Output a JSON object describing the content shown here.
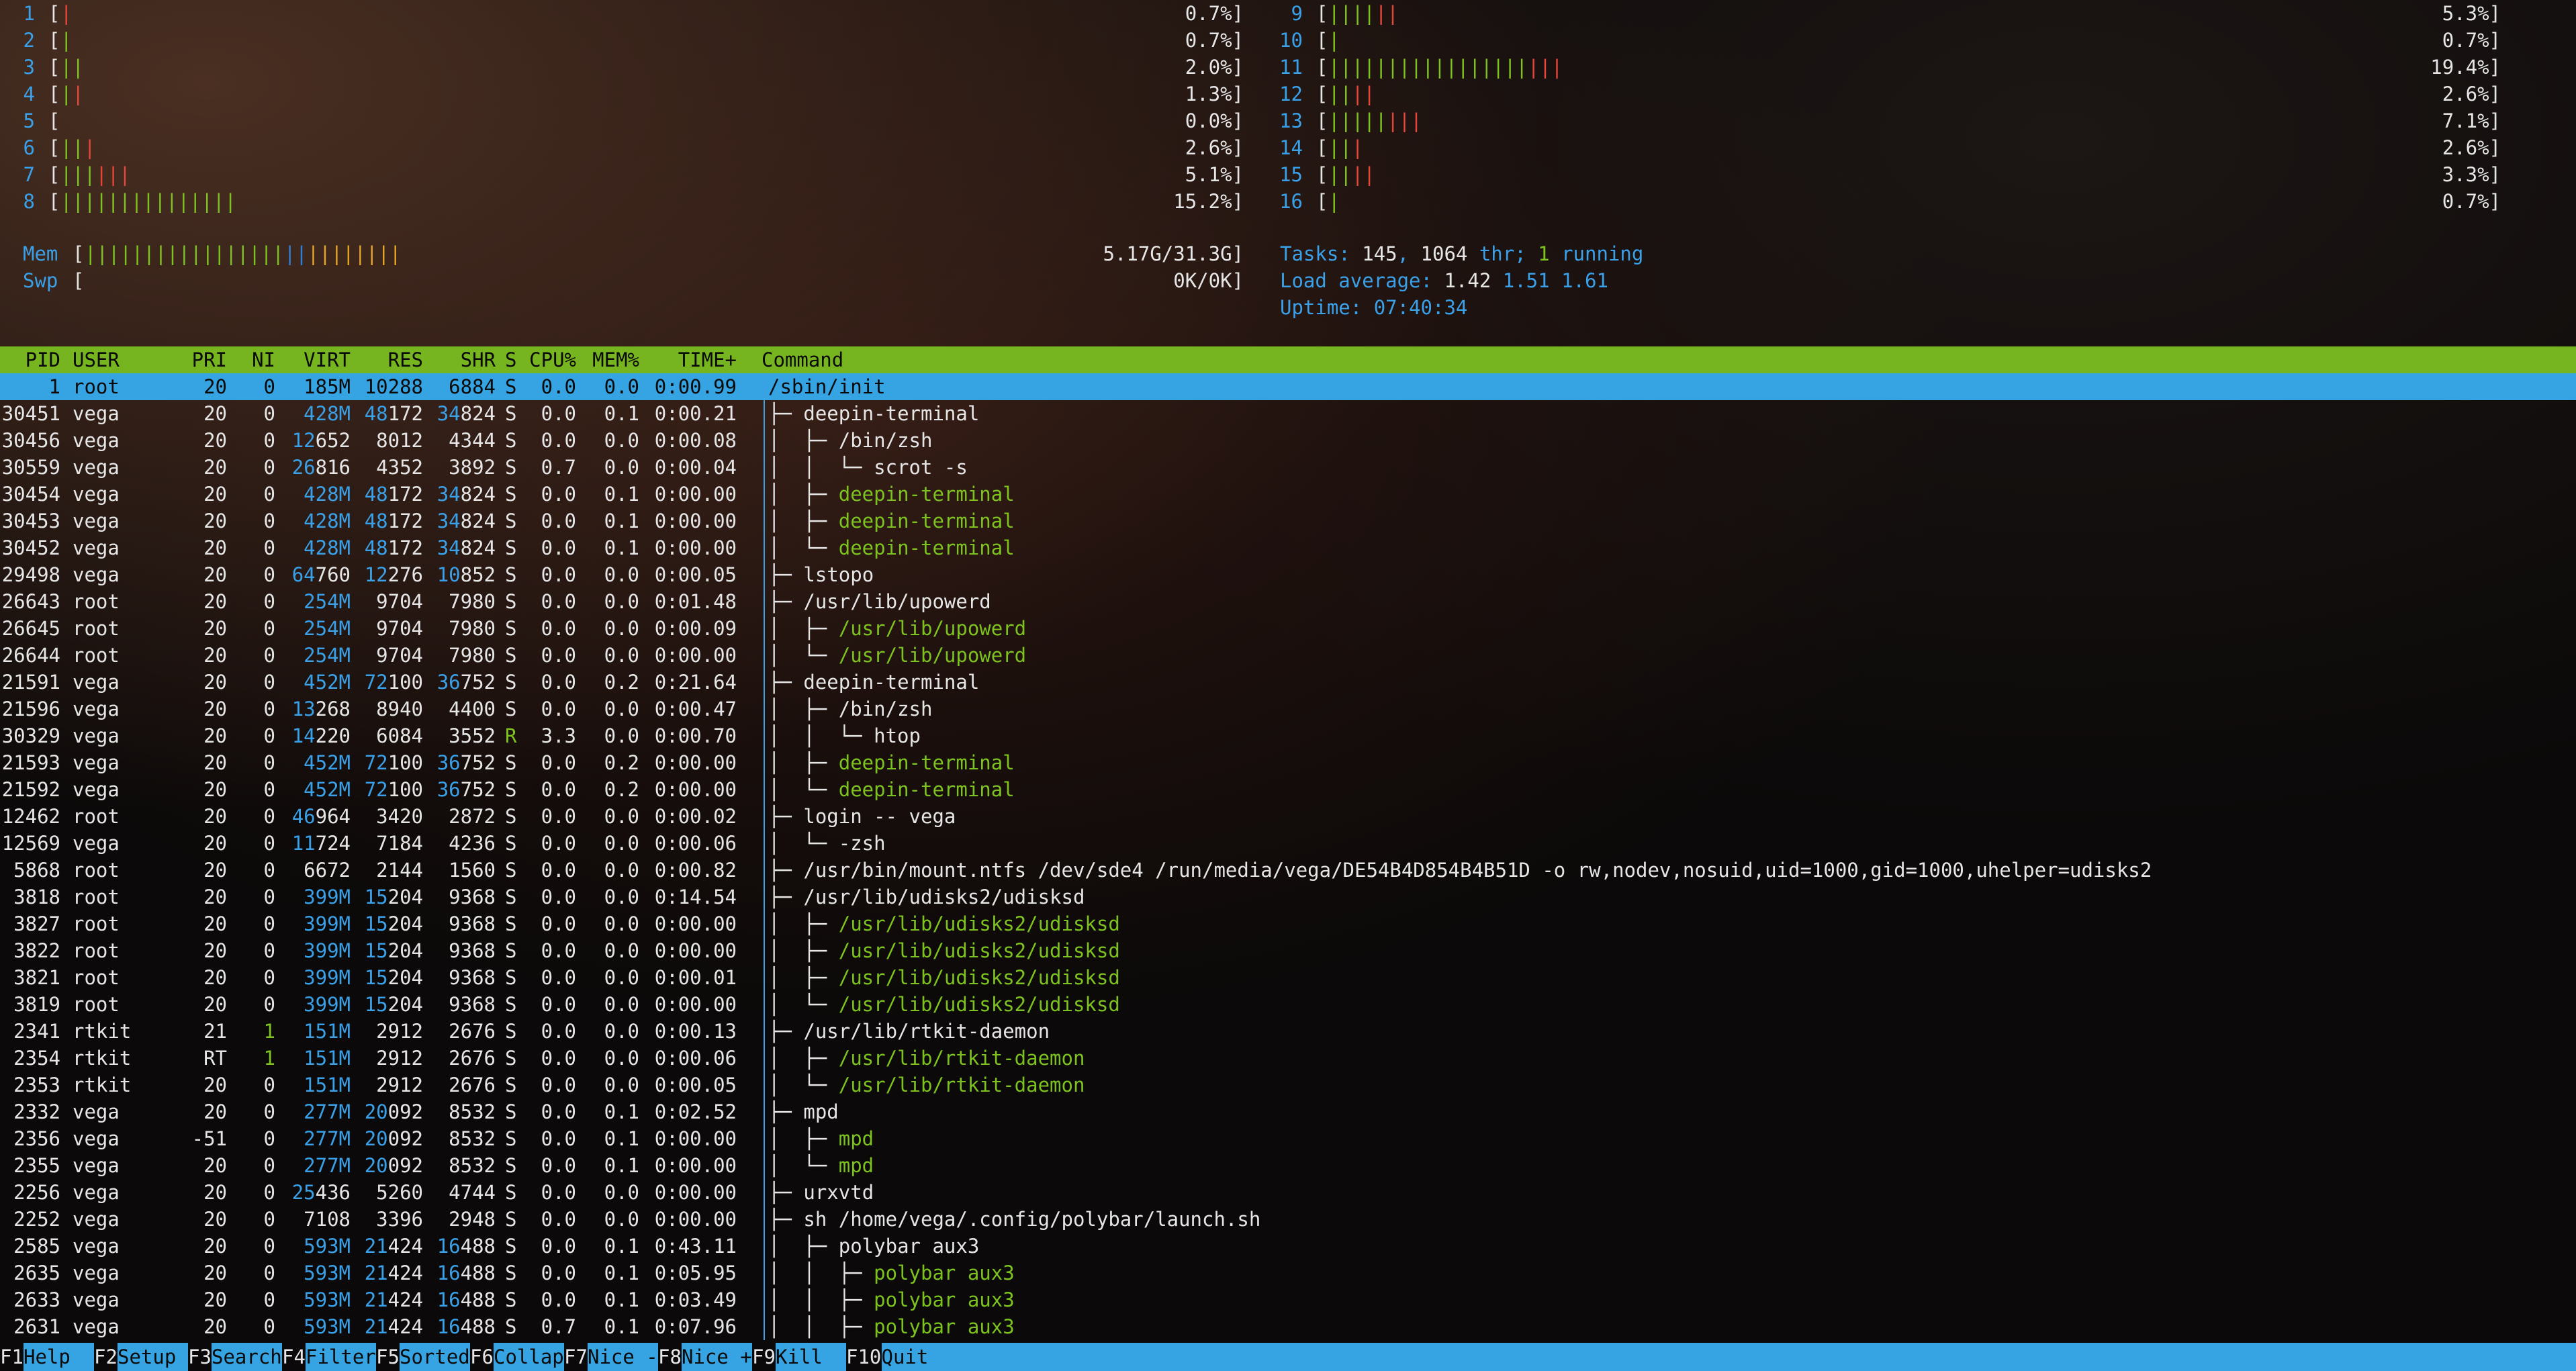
{
  "cpu_left": [
    {
      "id": "1",
      "g": 0,
      "r": 1,
      "val": "0.7%]"
    },
    {
      "id": "2",
      "g": 1,
      "r": 0,
      "val": "0.7%]"
    },
    {
      "id": "3",
      "g": 2,
      "r": 0,
      "val": "2.0%]"
    },
    {
      "id": "4",
      "g": 1,
      "r": 1,
      "val": "1.3%]"
    },
    {
      "id": "5",
      "g": 0,
      "r": 0,
      "val": "0.0%]"
    },
    {
      "id": "6",
      "g": 2,
      "r": 1,
      "val": "2.6%]"
    },
    {
      "id": "7",
      "g": 3,
      "r": 3,
      "val": "5.1%]"
    },
    {
      "id": "8",
      "g": 15,
      "r": 0,
      "val": "15.2%]"
    }
  ],
  "cpu_right": [
    {
      "id": "9",
      "g": 4,
      "r": 2,
      "val": "5.3%]"
    },
    {
      "id": "10",
      "g": 1,
      "r": 0,
      "val": "0.7%]"
    },
    {
      "id": "11",
      "g": 17,
      "r": 3,
      "val": "19.4%]"
    },
    {
      "id": "12",
      "g": 2,
      "r": 2,
      "val": "2.6%]"
    },
    {
      "id": "13",
      "g": 5,
      "r": 3,
      "val": "7.1%]"
    },
    {
      "id": "14",
      "g": 2,
      "r": 1,
      "val": "2.6%]"
    },
    {
      "id": "15",
      "g": 2,
      "r": 2,
      "val": "3.3%]"
    },
    {
      "id": "16",
      "g": 1,
      "r": 0,
      "val": "0.7%]"
    }
  ],
  "mem": {
    "label": "Mem",
    "g": 17,
    "b": 2,
    "y": 8,
    "val": "5.17G/31.3G]"
  },
  "swp": {
    "label": "Swp",
    "val": "0K/0K]"
  },
  "tasks": {
    "prefix": "Tasks: ",
    "tasks": "145",
    "sep1": ", ",
    "thr": "1064",
    "thr_label": " thr; ",
    "running": "1",
    "running_label": " running"
  },
  "load": {
    "prefix": "Load average: ",
    "l1": "1.42",
    "l5": "1.51",
    "l15": "1.61"
  },
  "uptime": {
    "prefix": "Uptime: ",
    "value": "07:40:34"
  },
  "columns": [
    "PID",
    "USER",
    "PRI",
    "NI",
    "VIRT",
    "RES",
    "SHR",
    "S",
    "CPU%",
    "MEM%",
    "TIME+",
    "Command"
  ],
  "processes": [
    {
      "pid": "1",
      "user": "root",
      "pri": "20",
      "ni": "0",
      "virt": "185M",
      "res": "10288",
      "shr": "6884",
      "s": "S",
      "cpu": "0.0",
      "mem": "0.0",
      "time": "0:00.99",
      "tree": "",
      "cmd": "/sbin/init",
      "thread": false
    },
    {
      "pid": "30451",
      "user": "vega",
      "pri": "20",
      "ni": "0",
      "virt": "428M",
      "res": "48172",
      "shr": "34824",
      "s": "S",
      "cpu": "0.0",
      "mem": "0.1",
      "time": "0:00.21",
      "tree": "├─ ",
      "cmd": "deepin-terminal",
      "thread": false
    },
    {
      "pid": "30456",
      "user": "vega",
      "pri": "20",
      "ni": "0",
      "virt": "12652",
      "res": "8012",
      "shr": "4344",
      "s": "S",
      "cpu": "0.0",
      "mem": "0.0",
      "time": "0:00.08",
      "tree": "│  ├─ ",
      "cmd": "/bin/zsh",
      "thread": false
    },
    {
      "pid": "30559",
      "user": "vega",
      "pri": "20",
      "ni": "0",
      "virt": "26816",
      "res": "4352",
      "shr": "3892",
      "s": "S",
      "cpu": "0.7",
      "mem": "0.0",
      "time": "0:00.04",
      "tree": "│  │  └─ ",
      "cmd": "scrot -s",
      "thread": false
    },
    {
      "pid": "30454",
      "user": "vega",
      "pri": "20",
      "ni": "0",
      "virt": "428M",
      "res": "48172",
      "shr": "34824",
      "s": "S",
      "cpu": "0.0",
      "mem": "0.1",
      "time": "0:00.00",
      "tree": "│  ├─ ",
      "cmd": "deepin-terminal",
      "thread": true
    },
    {
      "pid": "30453",
      "user": "vega",
      "pri": "20",
      "ni": "0",
      "virt": "428M",
      "res": "48172",
      "shr": "34824",
      "s": "S",
      "cpu": "0.0",
      "mem": "0.1",
      "time": "0:00.00",
      "tree": "│  ├─ ",
      "cmd": "deepin-terminal",
      "thread": true
    },
    {
      "pid": "30452",
      "user": "vega",
      "pri": "20",
      "ni": "0",
      "virt": "428M",
      "res": "48172",
      "shr": "34824",
      "s": "S",
      "cpu": "0.0",
      "mem": "0.1",
      "time": "0:00.00",
      "tree": "│  └─ ",
      "cmd": "deepin-terminal",
      "thread": true
    },
    {
      "pid": "29498",
      "user": "vega",
      "pri": "20",
      "ni": "0",
      "virt": "64760",
      "res": "12276",
      "shr": "10852",
      "s": "S",
      "cpu": "0.0",
      "mem": "0.0",
      "time": "0:00.05",
      "tree": "├─ ",
      "cmd": "lstopo",
      "thread": false
    },
    {
      "pid": "26643",
      "user": "root",
      "pri": "20",
      "ni": "0",
      "virt": "254M",
      "res": "9704",
      "shr": "7980",
      "s": "S",
      "cpu": "0.0",
      "mem": "0.0",
      "time": "0:01.48",
      "tree": "├─ ",
      "cmd": "/usr/lib/upowerd",
      "thread": false
    },
    {
      "pid": "26645",
      "user": "root",
      "pri": "20",
      "ni": "0",
      "virt": "254M",
      "res": "9704",
      "shr": "7980",
      "s": "S",
      "cpu": "0.0",
      "mem": "0.0",
      "time": "0:00.09",
      "tree": "│  ├─ ",
      "cmd": "/usr/lib/upowerd",
      "thread": true
    },
    {
      "pid": "26644",
      "user": "root",
      "pri": "20",
      "ni": "0",
      "virt": "254M",
      "res": "9704",
      "shr": "7980",
      "s": "S",
      "cpu": "0.0",
      "mem": "0.0",
      "time": "0:00.00",
      "tree": "│  └─ ",
      "cmd": "/usr/lib/upowerd",
      "thread": true
    },
    {
      "pid": "21591",
      "user": "vega",
      "pri": "20",
      "ni": "0",
      "virt": "452M",
      "res": "72100",
      "shr": "36752",
      "s": "S",
      "cpu": "0.0",
      "mem": "0.2",
      "time": "0:21.64",
      "tree": "├─ ",
      "cmd": "deepin-terminal",
      "thread": false
    },
    {
      "pid": "21596",
      "user": "vega",
      "pri": "20",
      "ni": "0",
      "virt": "13268",
      "res": "8940",
      "shr": "4400",
      "s": "S",
      "cpu": "0.0",
      "mem": "0.0",
      "time": "0:00.47",
      "tree": "│  ├─ ",
      "cmd": "/bin/zsh",
      "thread": false
    },
    {
      "pid": "30329",
      "user": "vega",
      "pri": "20",
      "ni": "0",
      "virt": "14220",
      "res": "6084",
      "shr": "3552",
      "s": "R",
      "cpu": "3.3",
      "mem": "0.0",
      "time": "0:00.70",
      "tree": "│  │  └─ ",
      "cmd": "htop",
      "thread": false
    },
    {
      "pid": "21593",
      "user": "vega",
      "pri": "20",
      "ni": "0",
      "virt": "452M",
      "res": "72100",
      "shr": "36752",
      "s": "S",
      "cpu": "0.0",
      "mem": "0.2",
      "time": "0:00.00",
      "tree": "│  ├─ ",
      "cmd": "deepin-terminal",
      "thread": true
    },
    {
      "pid": "21592",
      "user": "vega",
      "pri": "20",
      "ni": "0",
      "virt": "452M",
      "res": "72100",
      "shr": "36752",
      "s": "S",
      "cpu": "0.0",
      "mem": "0.2",
      "time": "0:00.00",
      "tree": "│  └─ ",
      "cmd": "deepin-terminal",
      "thread": true
    },
    {
      "pid": "12462",
      "user": "root",
      "pri": "20",
      "ni": "0",
      "virt": "46964",
      "res": "3420",
      "shr": "2872",
      "s": "S",
      "cpu": "0.0",
      "mem": "0.0",
      "time": "0:00.02",
      "tree": "├─ ",
      "cmd": "login -- vega",
      "thread": false
    },
    {
      "pid": "12569",
      "user": "vega",
      "pri": "20",
      "ni": "0",
      "virt": "11724",
      "res": "7184",
      "shr": "4236",
      "s": "S",
      "cpu": "0.0",
      "mem": "0.0",
      "time": "0:00.06",
      "tree": "│  └─ ",
      "cmd": "-zsh",
      "thread": false
    },
    {
      "pid": "5868",
      "user": "root",
      "pri": "20",
      "ni": "0",
      "virt": "6672",
      "res": "2144",
      "shr": "1560",
      "s": "S",
      "cpu": "0.0",
      "mem": "0.0",
      "time": "0:00.82",
      "tree": "├─ ",
      "cmd": "/usr/bin/mount.ntfs /dev/sde4 /run/media/vega/DE54B4D854B4B51D -o rw,nodev,nosuid,uid=1000,gid=1000,uhelper=udisks2",
      "thread": false
    },
    {
      "pid": "3818",
      "user": "root",
      "pri": "20",
      "ni": "0",
      "virt": "399M",
      "res": "15204",
      "shr": "9368",
      "s": "S",
      "cpu": "0.0",
      "mem": "0.0",
      "time": "0:14.54",
      "tree": "├─ ",
      "cmd": "/usr/lib/udisks2/udisksd",
      "thread": false
    },
    {
      "pid": "3827",
      "user": "root",
      "pri": "20",
      "ni": "0",
      "virt": "399M",
      "res": "15204",
      "shr": "9368",
      "s": "S",
      "cpu": "0.0",
      "mem": "0.0",
      "time": "0:00.00",
      "tree": "│  ├─ ",
      "cmd": "/usr/lib/udisks2/udisksd",
      "thread": true
    },
    {
      "pid": "3822",
      "user": "root",
      "pri": "20",
      "ni": "0",
      "virt": "399M",
      "res": "15204",
      "shr": "9368",
      "s": "S",
      "cpu": "0.0",
      "mem": "0.0",
      "time": "0:00.00",
      "tree": "│  ├─ ",
      "cmd": "/usr/lib/udisks2/udisksd",
      "thread": true
    },
    {
      "pid": "3821",
      "user": "root",
      "pri": "20",
      "ni": "0",
      "virt": "399M",
      "res": "15204",
      "shr": "9368",
      "s": "S",
      "cpu": "0.0",
      "mem": "0.0",
      "time": "0:00.01",
      "tree": "│  ├─ ",
      "cmd": "/usr/lib/udisks2/udisksd",
      "thread": true
    },
    {
      "pid": "3819",
      "user": "root",
      "pri": "20",
      "ni": "0",
      "virt": "399M",
      "res": "15204",
      "shr": "9368",
      "s": "S",
      "cpu": "0.0",
      "mem": "0.0",
      "time": "0:00.00",
      "tree": "│  └─ ",
      "cmd": "/usr/lib/udisks2/udisksd",
      "thread": true
    },
    {
      "pid": "2341",
      "user": "rtkit",
      "pri": "21",
      "ni": "1",
      "virt": "151M",
      "res": "2912",
      "shr": "2676",
      "s": "S",
      "cpu": "0.0",
      "mem": "0.0",
      "time": "0:00.13",
      "tree": "├─ ",
      "cmd": "/usr/lib/rtkit-daemon",
      "thread": false
    },
    {
      "pid": "2354",
      "user": "rtkit",
      "pri": "RT",
      "ni": "1",
      "virt": "151M",
      "res": "2912",
      "shr": "2676",
      "s": "S",
      "cpu": "0.0",
      "mem": "0.0",
      "time": "0:00.06",
      "tree": "│  ├─ ",
      "cmd": "/usr/lib/rtkit-daemon",
      "thread": true
    },
    {
      "pid": "2353",
      "user": "rtkit",
      "pri": "20",
      "ni": "0",
      "virt": "151M",
      "res": "2912",
      "shr": "2676",
      "s": "S",
      "cpu": "0.0",
      "mem": "0.0",
      "time": "0:00.05",
      "tree": "│  └─ ",
      "cmd": "/usr/lib/rtkit-daemon",
      "thread": true
    },
    {
      "pid": "2332",
      "user": "vega",
      "pri": "20",
      "ni": "0",
      "virt": "277M",
      "res": "20092",
      "shr": "8532",
      "s": "S",
      "cpu": "0.0",
      "mem": "0.1",
      "time": "0:02.52",
      "tree": "├─ ",
      "cmd": "mpd",
      "thread": false
    },
    {
      "pid": "2356",
      "user": "vega",
      "pri": "-51",
      "ni": "0",
      "virt": "277M",
      "res": "20092",
      "shr": "8532",
      "s": "S",
      "cpu": "0.0",
      "mem": "0.1",
      "time": "0:00.00",
      "tree": "│  ├─ ",
      "cmd": "mpd",
      "thread": true
    },
    {
      "pid": "2355",
      "user": "vega",
      "pri": "20",
      "ni": "0",
      "virt": "277M",
      "res": "20092",
      "shr": "8532",
      "s": "S",
      "cpu": "0.0",
      "mem": "0.1",
      "time": "0:00.00",
      "tree": "│  └─ ",
      "cmd": "mpd",
      "thread": true
    },
    {
      "pid": "2256",
      "user": "vega",
      "pri": "20",
      "ni": "0",
      "virt": "25436",
      "res": "5260",
      "shr": "4744",
      "s": "S",
      "cpu": "0.0",
      "mem": "0.0",
      "time": "0:00.00",
      "tree": "├─ ",
      "cmd": "urxvtd",
      "thread": false
    },
    {
      "pid": "2252",
      "user": "vega",
      "pri": "20",
      "ni": "0",
      "virt": "7108",
      "res": "3396",
      "shr": "2948",
      "s": "S",
      "cpu": "0.0",
      "mem": "0.0",
      "time": "0:00.00",
      "tree": "├─ ",
      "cmd": "sh /home/vega/.config/polybar/launch.sh",
      "thread": false
    },
    {
      "pid": "2585",
      "user": "vega",
      "pri": "20",
      "ni": "0",
      "virt": "593M",
      "res": "21424",
      "shr": "16488",
      "s": "S",
      "cpu": "0.0",
      "mem": "0.1",
      "time": "0:43.11",
      "tree": "│  ├─ ",
      "cmd": "polybar aux3",
      "thread": false
    },
    {
      "pid": "2635",
      "user": "vega",
      "pri": "20",
      "ni": "0",
      "virt": "593M",
      "res": "21424",
      "shr": "16488",
      "s": "S",
      "cpu": "0.0",
      "mem": "0.1",
      "time": "0:05.95",
      "tree": "│  │  ├─ ",
      "cmd": "polybar aux3",
      "thread": true
    },
    {
      "pid": "2633",
      "user": "vega",
      "pri": "20",
      "ni": "0",
      "virt": "593M",
      "res": "21424",
      "shr": "16488",
      "s": "S",
      "cpu": "0.0",
      "mem": "0.1",
      "time": "0:03.49",
      "tree": "│  │  ├─ ",
      "cmd": "polybar aux3",
      "thread": true
    },
    {
      "pid": "2631",
      "user": "vega",
      "pri": "20",
      "ni": "0",
      "virt": "593M",
      "res": "21424",
      "shr": "16488",
      "s": "S",
      "cpu": "0.7",
      "mem": "0.1",
      "time": "0:07.96",
      "tree": "│  │  ├─ ",
      "cmd": "polybar aux3",
      "thread": true
    }
  ],
  "fkeys": [
    {
      "key": "F1",
      "label": "Help"
    },
    {
      "key": "F2",
      "label": "Setup"
    },
    {
      "key": "F3",
      "label": "Search"
    },
    {
      "key": "F4",
      "label": "Filter"
    },
    {
      "key": "F5",
      "label": "Sorted"
    },
    {
      "key": "F6",
      "label": "Collap"
    },
    {
      "key": "F7",
      "label": "Nice -"
    },
    {
      "key": "F8",
      "label": "Nice +"
    },
    {
      "key": "F9",
      "label": "Kill"
    },
    {
      "key": "F10",
      "label": "Quit"
    }
  ],
  "colors": {
    "header_bg": "#77b520",
    "selection_bg": "#36a3e3",
    "cyan": "#3aa0e8",
    "green": "#7dc21f",
    "red": "#e6453a",
    "blue": "#2f7fd6",
    "yellow": "#e3a42a"
  }
}
